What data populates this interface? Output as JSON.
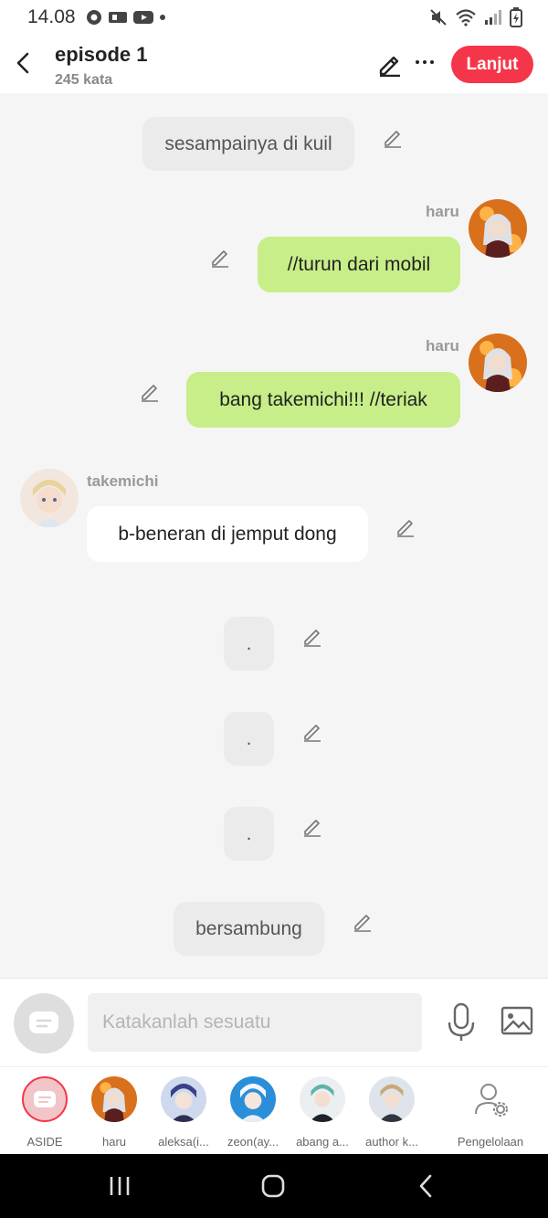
{
  "status": {
    "time": "14.08"
  },
  "header": {
    "title": "episode 1",
    "subtitle": "245 kata",
    "next_label": "Lanjut"
  },
  "messages": {
    "m1": {
      "text": "sesampainya di kuil"
    },
    "m2": {
      "sender": "haru",
      "text": "//turun dari mobil"
    },
    "m3": {
      "sender": "haru",
      "text": "bang takemichi!!! //teriak"
    },
    "m4": {
      "sender": "takemichi",
      "text": "b-beneran di jemput dong"
    },
    "m5": {
      "text": "."
    },
    "m6": {
      "text": "."
    },
    "m7": {
      "text": "."
    },
    "m8": {
      "text": "bersambung"
    }
  },
  "input": {
    "placeholder": "Katakanlah sesuatu"
  },
  "characters": [
    {
      "label": "ASIDE"
    },
    {
      "label": "haru"
    },
    {
      "label": "aleksa(i..."
    },
    {
      "label": "zeon(ay..."
    },
    {
      "label": "abang a..."
    },
    {
      "label": "author k..."
    },
    {
      "label": "Pengelolaan"
    }
  ],
  "colors": {
    "accent": "#f5364a",
    "my_bubble": "#c7ee88",
    "narration_bubble": "#ebebeb"
  },
  "icons": [
    "back-arrow-icon",
    "pencil-icon",
    "more-icon",
    "mic-icon",
    "image-icon",
    "manage-user-icon",
    "aside-icon"
  ]
}
